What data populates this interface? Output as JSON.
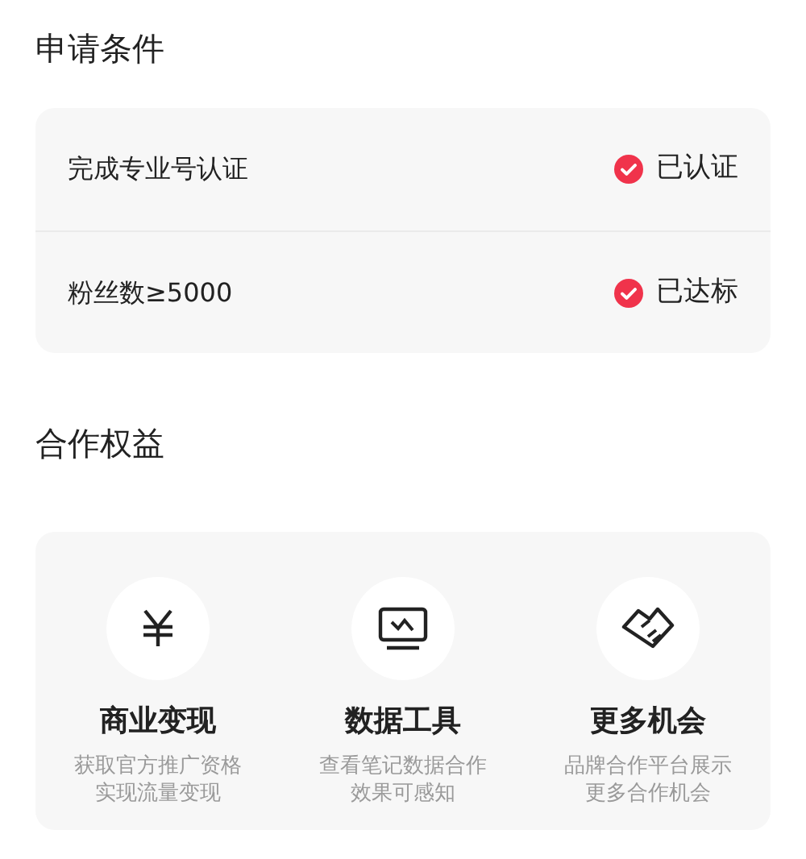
{
  "requirements": {
    "title": "申请条件",
    "items": [
      {
        "label": "完成专业号认证",
        "status": "已认证",
        "met": true
      },
      {
        "label": "粉丝数≥5000",
        "status": "已达标",
        "met": true
      }
    ]
  },
  "benefits": {
    "title": "合作权益",
    "items": [
      {
        "kind": "yen",
        "title": "商业变现",
        "description": [
          "获取官方推广资格",
          "实现流量变现"
        ]
      },
      {
        "kind": "monitor",
        "title": "数据工具",
        "description": [
          "查看笔记数据合作",
          "效果可感知"
        ]
      },
      {
        "kind": "handshake",
        "title": "更多机会",
        "description": [
          "品牌合作平台展示",
          "更多合作机会"
        ]
      }
    ]
  }
}
